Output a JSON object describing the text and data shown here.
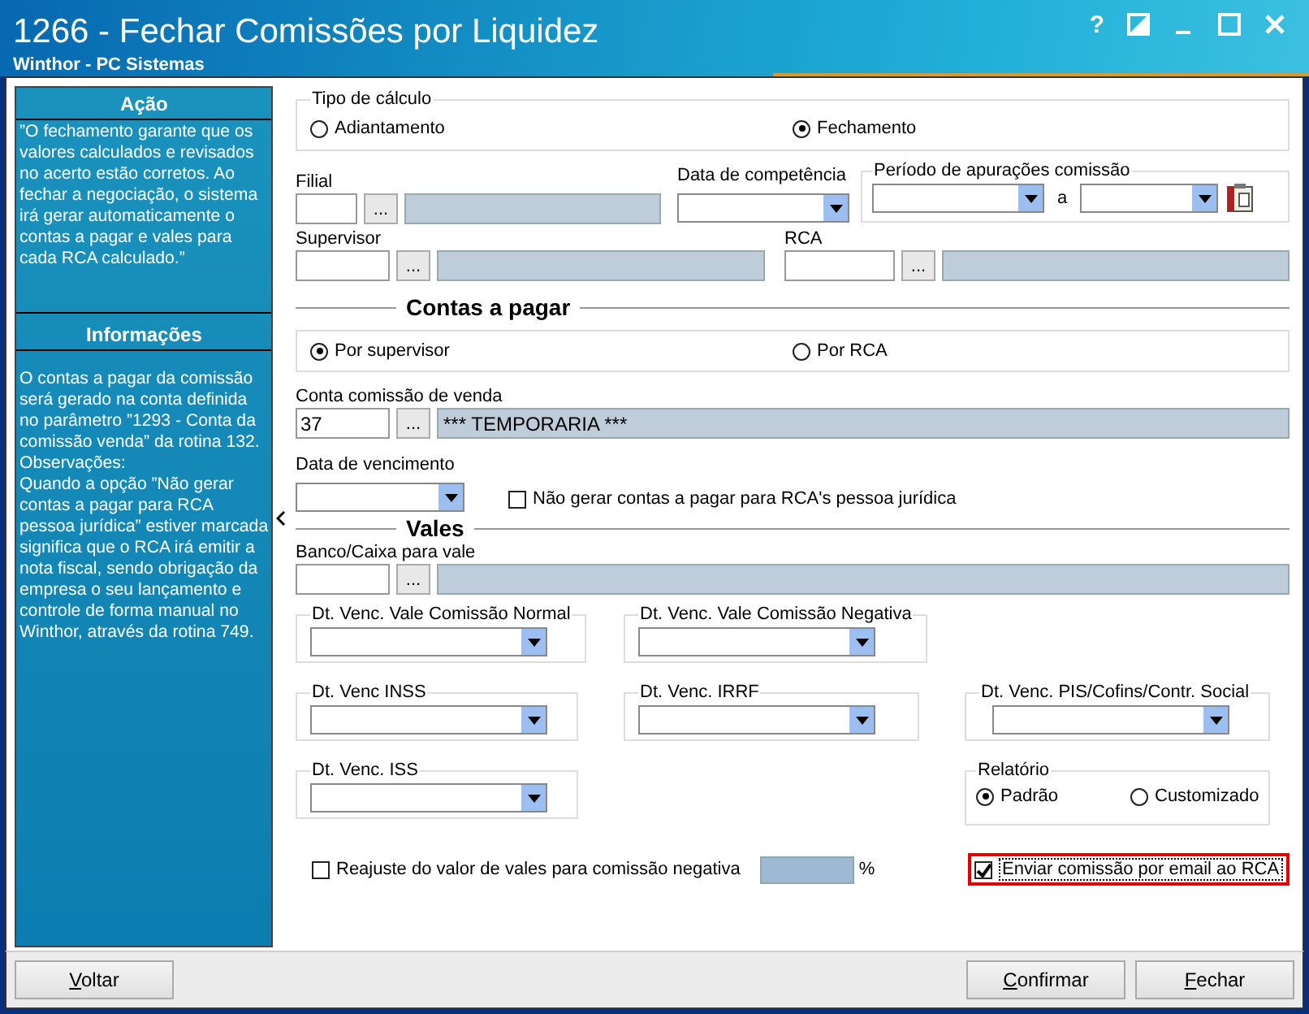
{
  "window": {
    "title": "1266 - Fechar Comissões por Liquidez",
    "subtitle": "Winthor - PC Sistemas",
    "help": "?"
  },
  "sidebar": {
    "sections": [
      {
        "title": "Ação",
        "text": "”O fechamento garante que os valores calculados e revisados no acerto estão corretos. Ao fechar a negociação, o sistema irá gerar automaticamente o contas a pagar e vales para cada RCA calculado.”"
      },
      {
        "title": "Informações",
        "text": "O contas a pagar da comissão será gerado na conta definida no parâmetro ”1293 - Conta da comissão venda” da rotina 132.\nObservações:\nQuando a opção ”Não gerar contas a pagar para RCA pessoa jurídica” estiver marcada significa que o RCA irá emitir a nota fiscal, sendo obrigação da empresa o seu lançamento e controle de forma manual no Winthor, através da rotina 749."
      }
    ]
  },
  "tipo_calculo": {
    "legend": "Tipo de cálculo",
    "options": [
      {
        "label": "Adiantamento",
        "selected": false
      },
      {
        "label": "Fechamento",
        "selected": true
      }
    ]
  },
  "filial": {
    "label": "Filial",
    "lookup": "..."
  },
  "data_competencia": {
    "label": "Data de competência"
  },
  "periodo": {
    "legend": "Período de apurações comissão",
    "separator": "a"
  },
  "supervisor": {
    "label": "Supervisor",
    "lookup": "..."
  },
  "rca": {
    "label": "RCA",
    "lookup": "..."
  },
  "contas_a_pagar": {
    "heading": "Contas a pagar",
    "options": [
      {
        "label": "Por supervisor",
        "selected": true
      },
      {
        "label": "Por RCA",
        "selected": false
      }
    ],
    "conta_comissao": {
      "label": "Conta comissão de venda",
      "code": "37",
      "lookup": "...",
      "description": "*** TEMPORARIA ***"
    },
    "data_vencimento": {
      "label": "Data de vencimento"
    },
    "nao_gerar": {
      "label": "Não gerar contas a pagar para RCA's pessoa jurídica",
      "checked": false
    }
  },
  "vales": {
    "heading": "Vales",
    "banco_caixa": {
      "label": "Banco/Caixa para vale",
      "lookup": "..."
    },
    "vencimentos": [
      {
        "legend": "Dt. Venc. Vale Comissão Normal"
      },
      {
        "legend": "Dt. Venc. Vale Comissão Negativa"
      },
      {
        "legend": "Dt. Venc INSS"
      },
      {
        "legend": "Dt.  Venc. IRRF"
      },
      {
        "legend": "Dt. Venc.  PIS/Cofins/Contr. Social"
      },
      {
        "legend": "Dt. Venc. ISS"
      }
    ],
    "relatorio": {
      "legend": "Relatório",
      "options": [
        {
          "label": "Padrão",
          "selected": true
        },
        {
          "label": "Customizado",
          "selected": false
        }
      ]
    },
    "reajuste": {
      "label": "Reajuste do valor de vales para comissão negativa",
      "checked": false,
      "unit": "%"
    },
    "enviar_email": {
      "label": "Enviar comissão por email ao RCA",
      "checked": true,
      "highlighted": true
    }
  },
  "buttons": [
    {
      "label": "Voltar"
    },
    {
      "label": "Confirmar"
    },
    {
      "label": "Fechar"
    }
  ]
}
